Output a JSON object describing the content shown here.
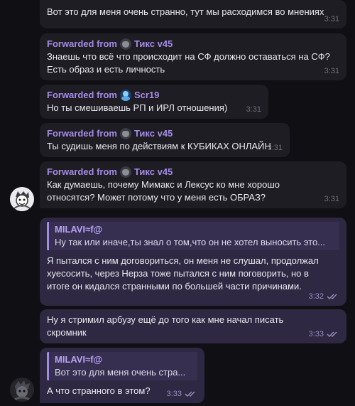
{
  "messages": [
    {
      "text": "Вот это для меня очень странно, тут мы расходимся во мнениях",
      "time": "3:31"
    },
    {
      "forwarded_label": "Forwarded from",
      "from": "Тикс v45",
      "text": "Знаешь что всё что происходит на СФ должно оставаться на СФ?\nЕсть образ и есть личность",
      "time": "3:31"
    },
    {
      "forwarded_label": "Forwarded from",
      "from": "Scr19",
      "text": "Но ты смешиваешь РП и ИРЛ отношения)",
      "time": "3:31"
    },
    {
      "forwarded_label": "Forwarded from",
      "from": "Тикс v45",
      "text": "Ты судишь меня по действиям к КУБИКАХ ОНЛАЙН",
      "time": "3:31"
    },
    {
      "forwarded_label": "Forwarded from",
      "from": "Тикс v45",
      "text": "Как думаешь, почему Мимакс и Лексус ко мне хорошо\nотносятся? Может потому что у меня есть ОБРАЗ?",
      "time": "3:31"
    }
  ],
  "outgoing": [
    {
      "reply_name": "MILAVI≈f@",
      "reply_text": "Ну так или иначе,ты знал о том,что он не хотел выносить это...",
      "text": "Я пытался с ним договориться, он меня не слушал, продолжал\nхуесосить, через Нерза тоже пытался с ним поговорить, но в\nитоге он кидался странными по большей части причинами.",
      "time": "3:32"
    },
    {
      "text": "Ну я стримил арбузу ещё до того как мне начал писать\nскромник",
      "time": "3:33"
    },
    {
      "reply_name": "MILAVI≈f@",
      "reply_text": "Вот это для меня очень стра...",
      "text": "А что странного в этом?",
      "time": "3:33"
    }
  ],
  "colors": {
    "accent": "#a48ce4",
    "outgoing_bg": "#2e2843",
    "incoming_bg": "#1e1d24"
  }
}
